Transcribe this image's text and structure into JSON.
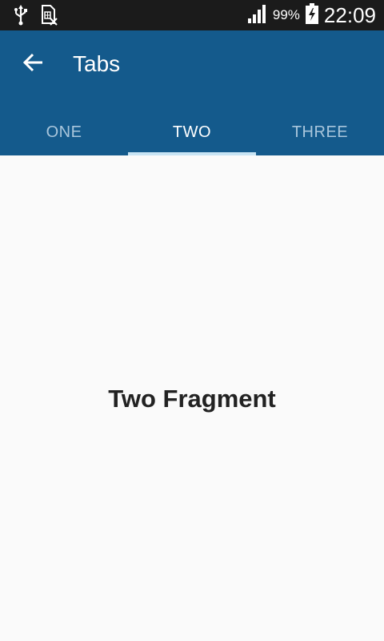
{
  "status_bar": {
    "icons": [
      "usb-icon",
      "sim-card-error-icon",
      "signal-icon",
      "battery-charging-icon"
    ],
    "battery_percent": "99%",
    "time": "22:09"
  },
  "app_bar": {
    "back_icon": "arrow-back-icon",
    "title": "Tabs"
  },
  "tabs": [
    {
      "label": "ONE",
      "selected": false
    },
    {
      "label": "TWO",
      "selected": true
    },
    {
      "label": "THREE",
      "selected": false
    }
  ],
  "content": {
    "text": "Two Fragment"
  },
  "colors": {
    "status_bar": "#1b1b1b",
    "primary": "#145a8c",
    "tab_indicator": "#c8e4f4",
    "tab_unselected": "#a9c6dc",
    "background": "#fafafa",
    "text_dark": "#222222"
  }
}
